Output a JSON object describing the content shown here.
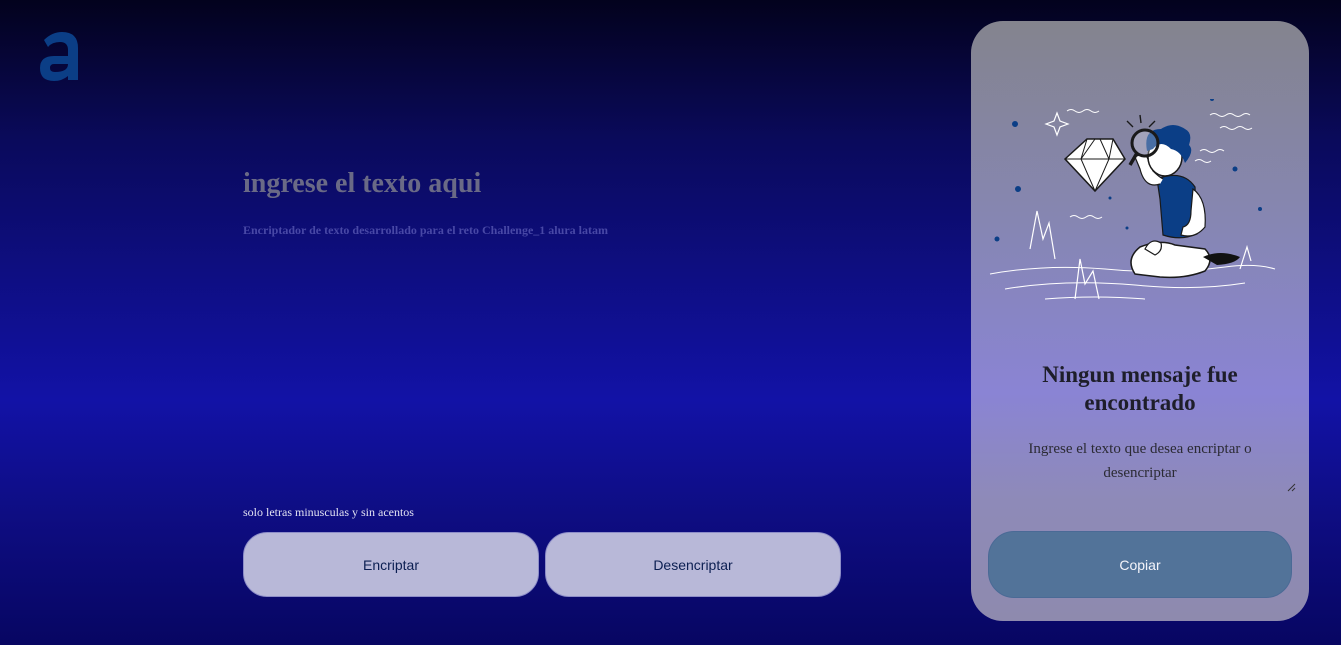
{
  "logo": {
    "letter": "a",
    "color": "#0b3e86"
  },
  "editor": {
    "placeholder": "ingrese el texto aqui",
    "subtitle": "Encriptador de texto desarrollado para el reto Challenge_1 alura latam",
    "hint": "solo letras minusculas y sin acentos"
  },
  "buttons": {
    "encrypt": "Encriptar",
    "decrypt": "Desencriptar",
    "copy": "Copiar"
  },
  "result": {
    "title": "Ningun mensaje fue encontrado",
    "text": "Ingrese el texto que desea encriptar o desencriptar",
    "illustration": "person-with-magnifying-glass-looking-at-diamond"
  },
  "colors": {
    "button_bg": "#b8b8d8",
    "copy_bg": "#527399",
    "accent_blue": "#0b3e86"
  }
}
